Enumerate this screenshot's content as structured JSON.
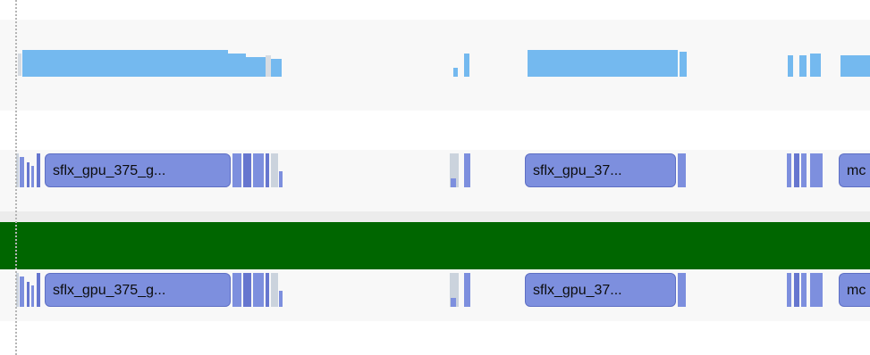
{
  "slices_track_1": {
    "slice_a_label": "sflx_gpu_375_g...",
    "slice_b_label": "sflx_gpu_37...",
    "slice_c_label": "mc"
  },
  "slices_track_2": {
    "slice_a_label": "sflx_gpu_375_g...",
    "slice_b_label": "sflx_gpu_37...",
    "slice_c_label": "mc"
  },
  "colors": {
    "utilization_bar": "#74b9ef",
    "slice_fill": "#7d8fde",
    "slice_border": "#5e6fc4",
    "highlight_band": "#006600"
  }
}
